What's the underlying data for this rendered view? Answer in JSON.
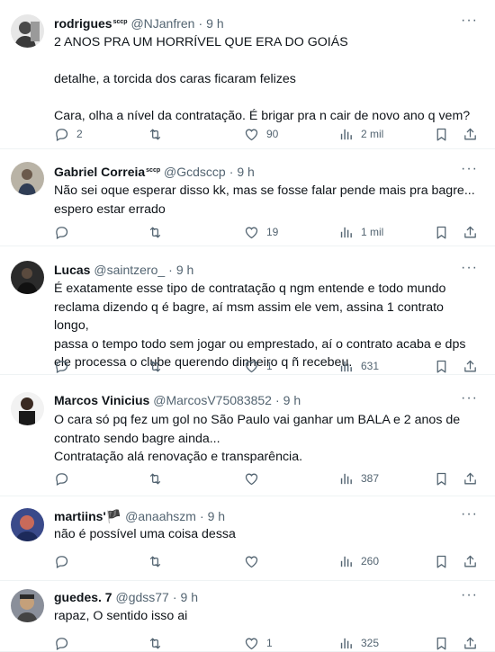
{
  "tweets": [
    {
      "name": "rodrigues",
      "badge": "sccp",
      "handle": "@NJanfren",
      "time": "9 h",
      "lines": [
        "2 ANOS PRA UM HORRÍVEL QUE ERA DO GOIÁS",
        "",
        "detalhe, a torcida dos caras ficaram felizes",
        "",
        "Cara, olha a nível da contratação. É brigar pra n cair de novo ano q vem?"
      ],
      "replies": "2",
      "retweets": "",
      "likes": "90",
      "views": "2 mil"
    },
    {
      "name": "Gabriel Correia",
      "badge": "sccp",
      "handle": "@Gcdsccp",
      "time": "9 h",
      "lines": [
        "Não sei oque esperar disso kk, mas se fosse falar pende mais pra bagre...",
        "espero estar errado"
      ],
      "replies": "",
      "retweets": "",
      "likes": "19",
      "views": "1 mil"
    },
    {
      "name": "Lucas",
      "badge": "",
      "handle": "@saintzero_",
      "time": "9 h",
      "lines": [
        "É exatamente esse tipo de contratação q ngm entende e todo mundo",
        "reclama dizendo q é bagre, aí msm assim ele vem, assina 1 contrato longo,",
        "passa o tempo todo sem jogar ou emprestado, aí o contrato acaba e dps",
        "ele processa o clube querendo dinheiro q ñ recebeu."
      ],
      "replies": "",
      "retweets": "",
      "likes": "1",
      "views": "631"
    },
    {
      "name": "Marcos Vinicius",
      "badge": "",
      "handle": "@MarcosV75083852",
      "time": "9 h",
      "lines": [
        "O cara só pq fez um gol no São Paulo vai ganhar um BALA e 2 anos de",
        "contrato sendo bagre ainda...",
        "Contratação alá renovação e transparência."
      ],
      "replies": "",
      "retweets": "",
      "likes": "",
      "views": "387"
    },
    {
      "name": "martiins'",
      "badge": "",
      "flag": "🏴",
      "handle": "@anaahszm",
      "time": "9 h",
      "lines": [
        "não é possível uma coisa dessa"
      ],
      "replies": "",
      "retweets": "",
      "likes": "",
      "views": "260"
    },
    {
      "name": "guedes. 7",
      "badge": "",
      "handle": "@gdss77",
      "time": "9 h",
      "lines": [
        "rapaz, O sentido isso ai"
      ],
      "replies": "",
      "retweets": "",
      "likes": "1",
      "views": "325"
    }
  ],
  "dot": "·",
  "icons": [
    "reply-icon",
    "retweet-icon",
    "like-icon",
    "views-icon",
    "bookmark-icon",
    "share-icon",
    "more-icon"
  ],
  "colors": {
    "text": "#0f1419",
    "muted": "#536471",
    "divider": "#eff3f4"
  }
}
